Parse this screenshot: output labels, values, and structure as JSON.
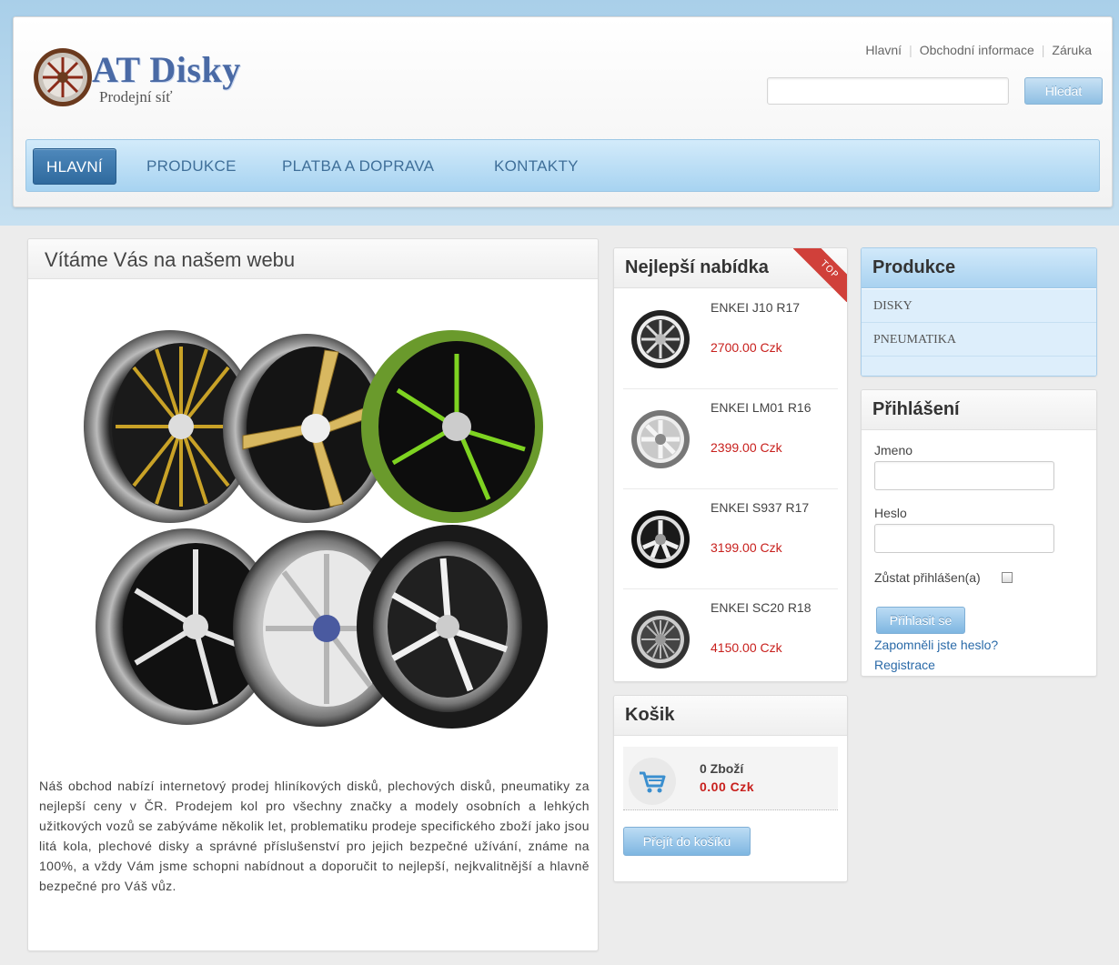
{
  "brand": {
    "title": "AT Disky",
    "subtitle": "Prodejní síť"
  },
  "top_links": [
    "Hlavní",
    "Obchodní informace",
    "Záruka"
  ],
  "search": {
    "value": "",
    "placeholder": "",
    "button_label": "Hledat"
  },
  "nav": {
    "items": [
      "HLAVNÍ",
      "PRODUKCE",
      "PLATBA A DOPRAVA",
      "KONTAKTY"
    ],
    "active": "HLAVNÍ"
  },
  "welcome": {
    "title": "Vítáme Vás na našem webu",
    "text": "Náš obchod nabízí internetový prodej hliníkových disků, plechových disků, pneumatiky za nejlepší ceny v ČR. Prodejem kol pro všechny značky a modely osobních a lehkých užitkových vozů se zabýváme několik let, problematiku prodeje specifického zboží jako jsou litá kola, plechové disky a správné příslušenství pro jejich bezpečné užívání, známe na 100%, a vždy Vám jsme schopni nabídnout a doporučit to nejlepší, nejkvalitnější a hlavně bezpečné pro Váš vůz."
  },
  "best_offer": {
    "title": "Nejlepší nabídka",
    "ribbon": "TOP",
    "products": [
      {
        "name": "ENKEI J10 R17",
        "price": "2700.00 Czk"
      },
      {
        "name": "ENKEI LM01 R16",
        "price": "2399.00 Czk"
      },
      {
        "name": "ENKEI S937 R17",
        "price": "3199.00 Czk"
      },
      {
        "name": "ENKEI SC20 R18",
        "price": "4150.00 Czk"
      }
    ]
  },
  "cart": {
    "title": "Košik",
    "count": "0 Zboží",
    "total": "0.00 Czk",
    "button_label": "Přejít do košíku"
  },
  "categories": {
    "title": "Produkce",
    "items": [
      "DISKY",
      "PNEUMATIKA"
    ]
  },
  "login": {
    "title": "Přihlášení",
    "username_label": "Jmeno",
    "username_value": "",
    "password_label": "Heslo",
    "password_value": "",
    "remember_label": "Zůstat přihlášen(a)",
    "remember_checked": false,
    "button_label": "Přihlasit se",
    "forgot_link": "Zapomněli jste heslo?",
    "register_link": "Registrace"
  },
  "colors": {
    "accent": "#2f6a9e",
    "price": "#c8201d",
    "link": "#2a6aa8"
  }
}
